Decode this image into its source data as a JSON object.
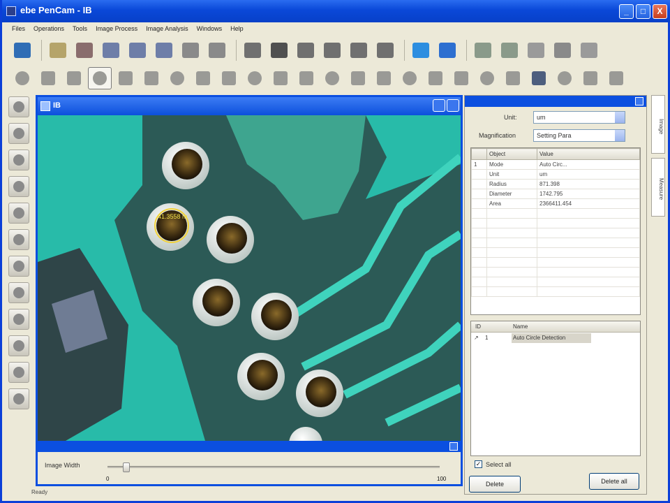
{
  "window": {
    "title": "ebe PenCam - IB",
    "min_label": "_",
    "max_label": "□",
    "close_label": "X"
  },
  "menu": [
    "Files",
    "Operations",
    "Tools",
    "Image Process",
    "Image Analysis",
    "Windows",
    "Help"
  ],
  "toolbar_top": [
    {
      "icon": "monitor-icon",
      "color": "#2f6db5"
    },
    {
      "icon": "open-folder-icon",
      "color": "#b5a46a"
    },
    {
      "icon": "network-icon",
      "color": "#8a6d6d"
    },
    {
      "icon": "save-icon",
      "color": "#6e7ea8"
    },
    {
      "icon": "save-as-icon",
      "color": "#6e7ea8"
    },
    {
      "icon": "save-all-icon",
      "color": "#6e7ea8"
    },
    {
      "icon": "capture-icon",
      "color": "#8a8a8a"
    },
    {
      "icon": "print-icon",
      "color": "#8a8a8a"
    },
    {
      "icon": "play-icon",
      "color": "#707070"
    },
    {
      "icon": "pause-icon",
      "color": "#505050"
    },
    {
      "icon": "stop-icon",
      "color": "#707070"
    },
    {
      "icon": "fit-window-icon",
      "color": "#707070"
    },
    {
      "icon": "record-icon",
      "color": "#707070"
    },
    {
      "icon": "film-icon",
      "color": "#707070"
    },
    {
      "icon": "forward-arrow-icon",
      "color": "#2d8ee0"
    },
    {
      "icon": "undo-icon",
      "color": "#2d6fd0"
    },
    {
      "icon": "zoom-in-icon",
      "color": "#8a9a8a"
    },
    {
      "icon": "zoom-out-icon",
      "color": "#8a9a8a"
    },
    {
      "icon": "calibrate-icon",
      "color": "#9a9a9a"
    },
    {
      "icon": "puzzle-icon",
      "color": "#8a8a8a"
    },
    {
      "icon": "stack-icon",
      "color": "#9a9a9a"
    }
  ],
  "toolbar_measure": [
    "eraser-icon",
    "angle-icon",
    "circle-icon",
    "target-circle-icon",
    "wand-icon",
    "particles-icon",
    "grid-icon",
    "magnifier-icon",
    "line-icon",
    "rectangle-icon",
    "ellipse-icon",
    "arc-icon",
    "polyline-icon",
    "dot-icon",
    "point-to-point-icon",
    "perpendicular-icon",
    "sphere-icon",
    "angle-measure-icon",
    "cross-lines-icon",
    "parallel-icon",
    "text-tool-icon",
    "contrast-icon",
    "report-icon",
    "diamond-icon"
  ],
  "left_toolbar": [
    "tool-camera-icon",
    "tool-half-circle-icon",
    "tool-layers-icon",
    "tool-frame-icon",
    "tool-settings-icon",
    "tool-palette-icon",
    "tool-pointer-icon",
    "tool-hand-icon",
    "tool-stack-icon",
    "tool-triangle-icon",
    "tool-brush-icon",
    "tool-dome-icon"
  ],
  "image_window": {
    "title": "IB",
    "measurement_label": "41.3558 m",
    "zoom_label": "Image Width",
    "zoom_min": "0",
    "zoom_max": "100"
  },
  "right_panel": {
    "unit_label": "Unit:",
    "unit_value": "um",
    "magnification_label": "Magnification",
    "magnification_value": "Setting Para",
    "grid_headers": [
      "Object",
      "Value"
    ],
    "grid_rows": [
      {
        "index": "1",
        "object": "Mode",
        "value": "Auto Circ..."
      },
      {
        "index": "",
        "object": "Unit",
        "value": "um"
      },
      {
        "index": "",
        "object": "Radius",
        "value": "871.398"
      },
      {
        "index": "",
        "object": "Diameter",
        "value": "1742.795"
      },
      {
        "index": "",
        "object": "Area",
        "value": "2366411.454"
      }
    ],
    "list_headers": [
      "ID",
      "Name"
    ],
    "list_rows": [
      {
        "id": "1",
        "name": "Auto Circle Detection"
      }
    ],
    "select_all_label": "Select all",
    "delete_label": "Delete",
    "delete_all_label": "Delete all"
  },
  "right_strip_tabs": [
    "Image",
    "Measure"
  ],
  "status_text": "Ready"
}
